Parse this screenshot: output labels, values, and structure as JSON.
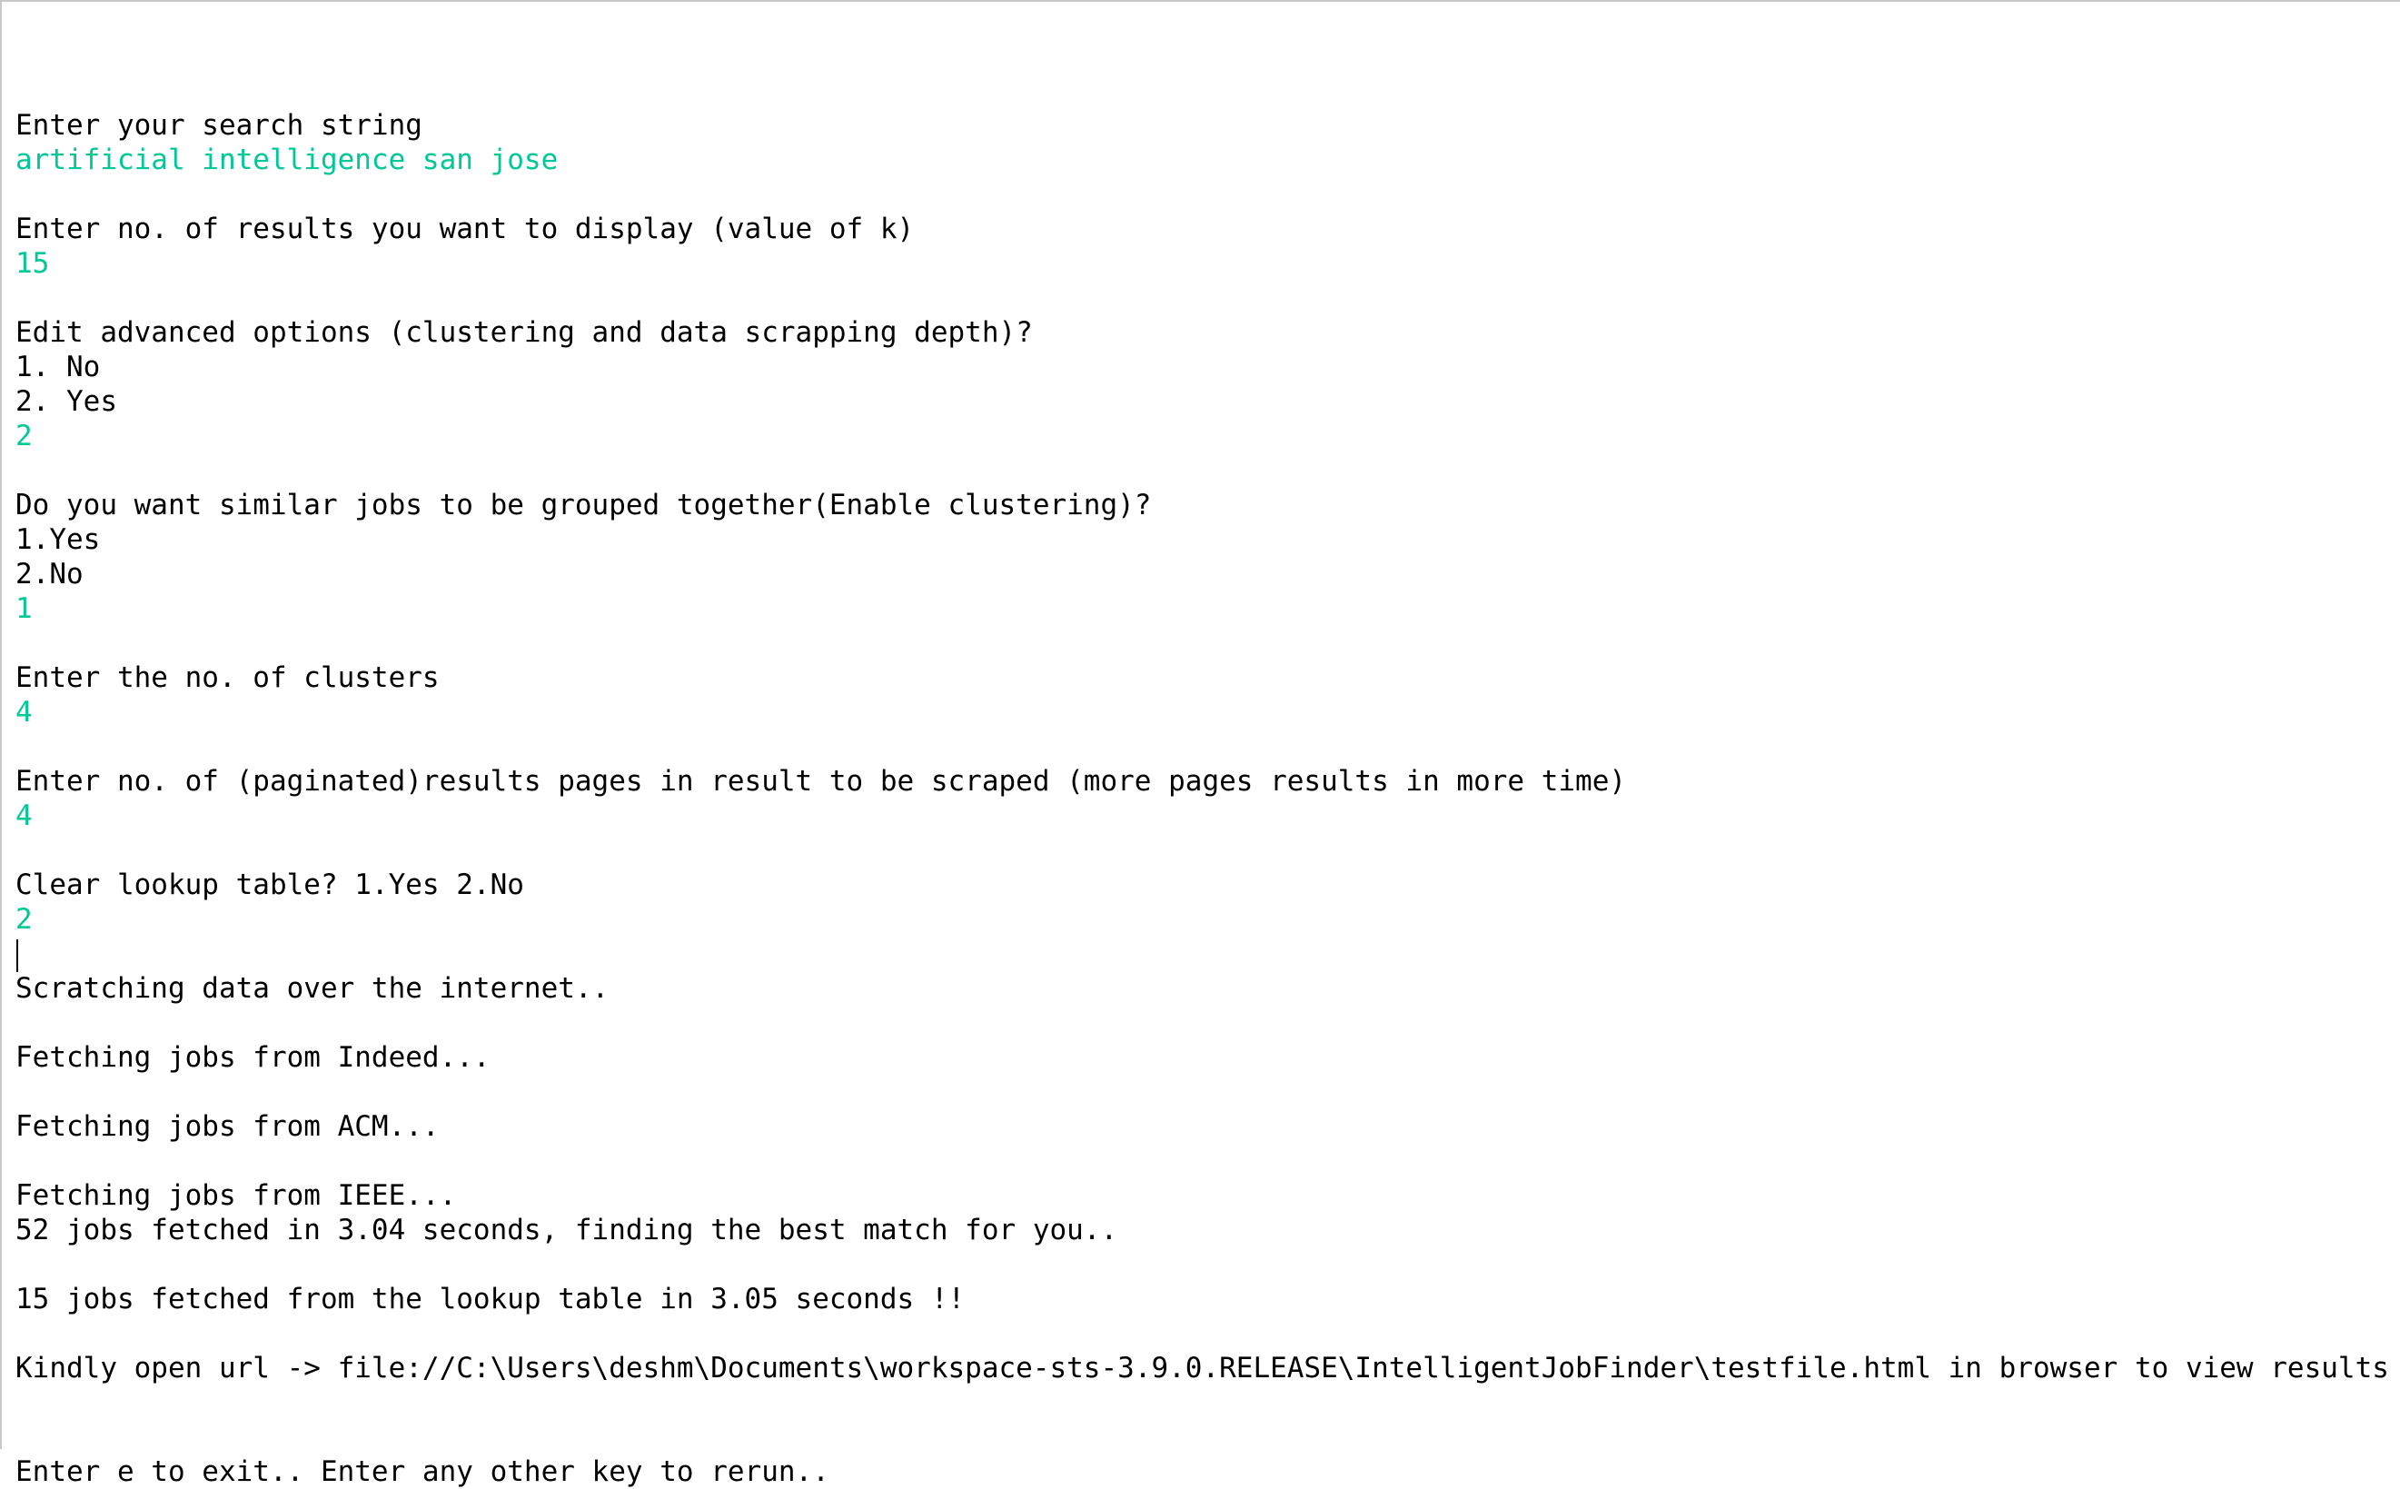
{
  "console": {
    "colors": {
      "output": "#000000",
      "input": "#00c896",
      "background": "#ffffff"
    },
    "lines": [
      {
        "text": "Enter your search string",
        "kind": "output"
      },
      {
        "text": "artificial intelligence san jose",
        "kind": "input"
      },
      {
        "text": "",
        "kind": "blank"
      },
      {
        "text": "Enter no. of results you want to display (value of k)",
        "kind": "output"
      },
      {
        "text": "15",
        "kind": "input"
      },
      {
        "text": "",
        "kind": "blank"
      },
      {
        "text": "Edit advanced options (clustering and data scrapping depth)?",
        "kind": "output"
      },
      {
        "text": "1. No",
        "kind": "output"
      },
      {
        "text": "2. Yes",
        "kind": "output"
      },
      {
        "text": "2",
        "kind": "input"
      },
      {
        "text": "",
        "kind": "blank"
      },
      {
        "text": "Do you want similar jobs to be grouped together(Enable clustering)?",
        "kind": "output"
      },
      {
        "text": "1.Yes",
        "kind": "output"
      },
      {
        "text": "2.No",
        "kind": "output"
      },
      {
        "text": "1",
        "kind": "input"
      },
      {
        "text": "",
        "kind": "blank"
      },
      {
        "text": "Enter the no. of clusters",
        "kind": "output"
      },
      {
        "text": "4",
        "kind": "input"
      },
      {
        "text": "",
        "kind": "blank"
      },
      {
        "text": "Enter no. of (paginated)results pages in result to be scraped (more pages results in more time)",
        "kind": "output"
      },
      {
        "text": "4",
        "kind": "input"
      },
      {
        "text": "",
        "kind": "blank"
      },
      {
        "text": "Clear lookup table? 1.Yes 2.No",
        "kind": "output"
      },
      {
        "text": "2",
        "kind": "input"
      },
      {
        "text": "",
        "kind": "caret"
      },
      {
        "text": "Scratching data over the internet..",
        "kind": "output"
      },
      {
        "text": "",
        "kind": "blank"
      },
      {
        "text": "Fetching jobs from Indeed...",
        "kind": "output"
      },
      {
        "text": "",
        "kind": "blank"
      },
      {
        "text": "Fetching jobs from ACM...",
        "kind": "output"
      },
      {
        "text": "",
        "kind": "blank"
      },
      {
        "text": "Fetching jobs from IEEE...",
        "kind": "output"
      },
      {
        "text": "52 jobs fetched in 3.04 seconds, finding the best match for you..",
        "kind": "output"
      },
      {
        "text": "",
        "kind": "blank"
      },
      {
        "text": "15 jobs fetched from the lookup table in 3.05 seconds !!",
        "kind": "output"
      },
      {
        "text": "",
        "kind": "blank"
      },
      {
        "text": "Kindly open url -> file://C:\\Users\\deshm\\Documents\\workspace-sts-3.9.0.RELEASE\\IntelligentJobFinder\\testfile.html in browser to view results",
        "kind": "output"
      },
      {
        "text": "",
        "kind": "blank"
      },
      {
        "text": "",
        "kind": "blank"
      },
      {
        "text": "Enter e to exit.. Enter any other key to rerun..",
        "kind": "output"
      }
    ]
  }
}
